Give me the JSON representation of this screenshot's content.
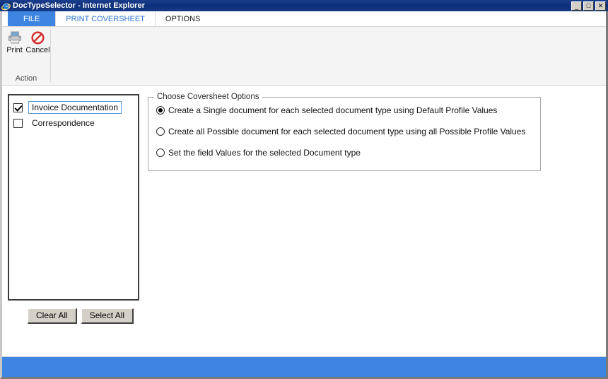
{
  "window": {
    "title": "DocTypeSelector - Internet Explorer",
    "app_icon": "internet-explorer-icon",
    "controls": {
      "minimize": "_",
      "maximize": "□",
      "close": "✕"
    }
  },
  "ribbon": {
    "tabs": [
      {
        "label": "FILE",
        "kind": "file",
        "active": false
      },
      {
        "label": "PRINT COVERSHEET",
        "kind": "normal",
        "active": true
      },
      {
        "label": "OPTIONS",
        "kind": "normal",
        "active": false
      }
    ],
    "groups": [
      {
        "label": "Action",
        "buttons": [
          {
            "label": "Print",
            "icon": "printer-icon"
          },
          {
            "label": "Cancel",
            "icon": "cancel-prohibition-icon"
          }
        ]
      }
    ]
  },
  "doc_types": {
    "items": [
      {
        "label": "Invoice Documentation",
        "checked": true,
        "selected": true
      },
      {
        "label": "Correspondence",
        "checked": false,
        "selected": false
      }
    ],
    "buttons": {
      "clear_all": "Clear All",
      "select_all": "Select All"
    }
  },
  "coversheet_options": {
    "legend": "Choose Coversheet Options",
    "options": [
      {
        "label": "Create a Single document for each selected document type using Default Profile Values",
        "selected": true
      },
      {
        "label": "Create all Possible document for each selected document type using all Possible Profile Values",
        "selected": false
      },
      {
        "label": "Set the field Values for the selected Document type",
        "selected": false
      }
    ]
  },
  "status_bar": {
    "text": ""
  },
  "colors": {
    "titlebar": "#153a86",
    "accent_blue": "#3d85e0",
    "active_tab_text": "#2e75d4",
    "selection_border": "#5a9bd8",
    "cancel_red": "#d32b2b",
    "ribbon_bg": "#f4f4f4"
  }
}
